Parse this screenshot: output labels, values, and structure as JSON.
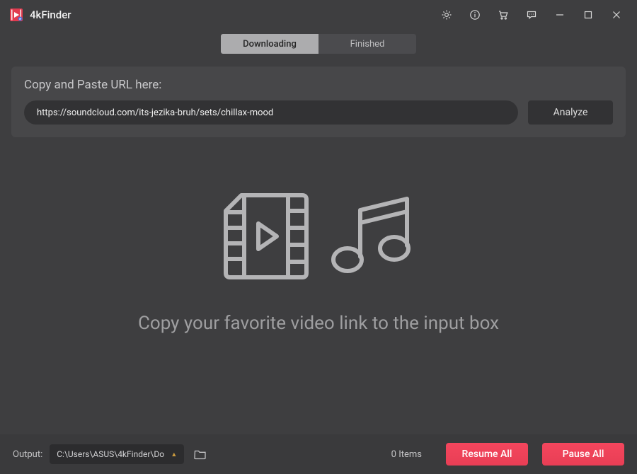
{
  "app": {
    "title": "4kFinder"
  },
  "tabs": {
    "downloading": "Downloading",
    "finished": "Finished"
  },
  "url": {
    "label": "Copy and Paste URL here:",
    "value": "https://soundcloud.com/its-jezika-bruh/sets/chillax-mood",
    "analyze": "Analyze"
  },
  "hero": {
    "text": "Copy your favorite video link to the input box"
  },
  "footer": {
    "output_label": "Output:",
    "output_path": "C:\\Users\\ASUS\\4kFinder\\Do",
    "items": "0 Items",
    "resume": "Resume All",
    "pause": "Pause All"
  }
}
